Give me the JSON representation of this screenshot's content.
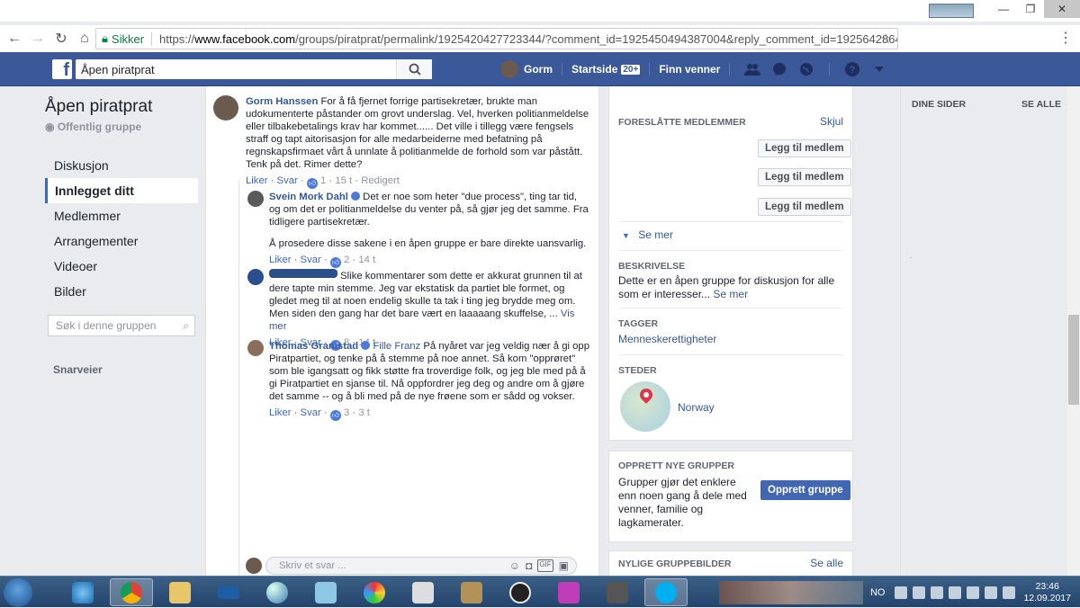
{
  "browser": {
    "secure_label": "Sikker",
    "url_prefix": "https://",
    "url_host": "www.facebook.com",
    "url_path": "/groups/piratprat/permalink/1925420427723344/?comment_id=1925450494387004&reply_comment_id=1925642864..."
  },
  "header": {
    "search_value": "Åpen piratprat",
    "user_name": "Gorm",
    "home_label": "Startside",
    "home_count": "20+",
    "friends_label": "Finn venner"
  },
  "sidebar": {
    "group_title": "Åpen piratprat",
    "group_type": "Offentlig gruppe",
    "items": [
      {
        "label": "Diskusjon"
      },
      {
        "label": "Innlegget ditt"
      },
      {
        "label": "Medlemmer"
      },
      {
        "label": "Arrangementer"
      },
      {
        "label": "Videoer"
      },
      {
        "label": "Bilder"
      }
    ],
    "search_placeholder": "Søk i denne gruppen",
    "shortcuts_label": "Snarveier"
  },
  "comments": [
    {
      "name": "Gorm Hanssen",
      "text": "For å få fjernet forrige partisekretær, brukte man udokumenterte påstander om grovt underslag. Vel, hverken politianmeldelse eller tilbakebetalings krav har kommet...... Det ville i tillegg være fengsels straff og tapt aitorisasjon for alle medarbeiderne med befatning på regnskapsfirmaet vårt å unnlate å politianmelde de forhold som var påstått. Tenk på det. Rimer dette?",
      "like": "Liker",
      "reply": "Svar",
      "likes": "1",
      "time": "15 t",
      "edited": "Redigert"
    },
    {
      "name": "Svein Mork Dahl",
      "text": "Det er noe som heter \"due process\", ting tar tid, og om det er politianmeldelse du venter på, så gjør jeg det samme. Fra tidligere partisekretær.",
      "text2": "Å prosedere disse sakene i en åpen gruppe er bare direkte uansvarlig.",
      "like": "Liker",
      "reply": "Svar",
      "likes": "2",
      "time": "14 t"
    },
    {
      "text": "Slike kommentarer som dette er akkurat grunnen til at dere tapte min stemme. Jeg var ekstatisk da partiet ble formet, og gledet meg til at noen endelig skulle ta tak i ting jeg brydde meg om. Men siden den gang har det bare vært en laaaaang skuffelse, ...",
      "more": "Vis mer",
      "like": "Liker",
      "reply": "Svar",
      "likes": "8",
      "time": "14 t"
    },
    {
      "name": "Thomas Gramstad",
      "tag": "Fille Franz",
      "text": "På nyåret var jeg veldig nær å gi opp Piratpartiet, og tenke på å stemme på noe annet. Så kom \"opprøret\" som ble igangsatt og fikk støtte fra troverdige folk, og jeg ble med på å gi Piratpartiet en sjanse til. Nå oppfordrer jeg deg og andre om å gjøre det samme -- og å bli med på de nye frøene som er sådd og vokser.",
      "like": "Liker",
      "reply": "Svar",
      "likes": "3",
      "time": "3 t"
    }
  ],
  "reply_box": {
    "placeholder": "Skriv et svar ..."
  },
  "right": {
    "suggested_heading": "Foreslåtte medlemmer",
    "hide": "Skjul",
    "add_member": "Legg til medlem",
    "see_more": "Se mer",
    "description_heading": "Beskrivelse",
    "description_text": "Dette er en åpen gruppe for diskusjon for alle som er interesser...",
    "description_more": "Se mer",
    "tags_heading": "Tagger",
    "tag_value": "Menneskerettigheter",
    "places_heading": "Steder",
    "place_value": "Norway",
    "create_heading": "Opprett nye grupper",
    "create_text": "Grupper gjør det enklere enn noen gang å dele med venner, familie og lagkamerater.",
    "create_button": "Opprett gruppe",
    "recent_heading": "Nylige gruppebilder",
    "see_all": "Se alle"
  },
  "far_right": {
    "pages_heading": "DINE SIDER",
    "see_all": "SE ALLE"
  },
  "taskbar": {
    "lang": "NO",
    "time": "23:46",
    "date": "12.09.2017"
  },
  "colors": {
    "fb_blue": "#3b5998",
    "link": "#365899",
    "like_blue": "#4d79d8"
  }
}
